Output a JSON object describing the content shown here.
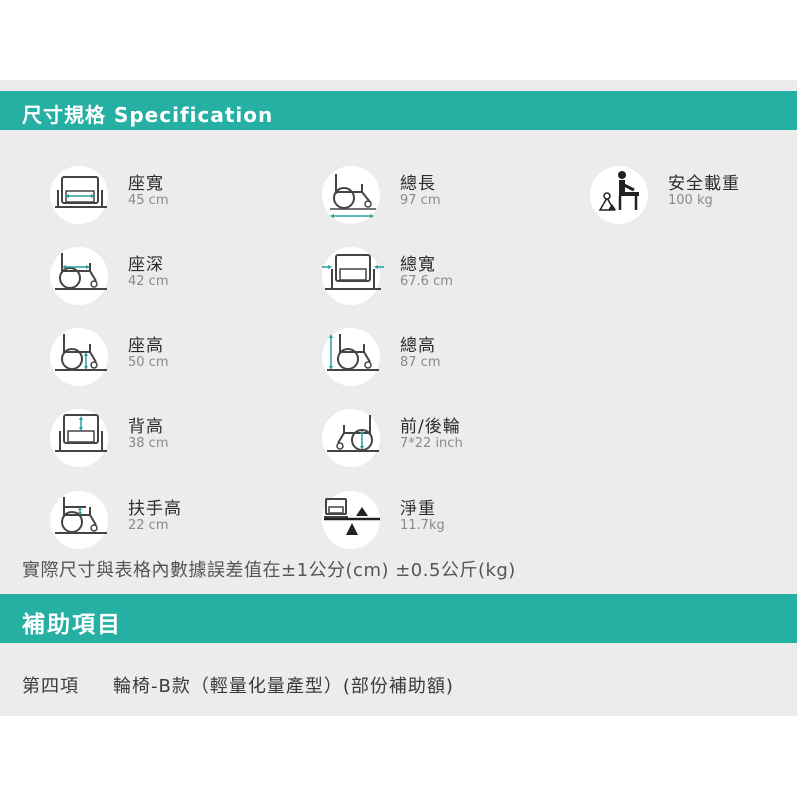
{
  "colors": {
    "accent": "#26b0a3",
    "icon_accent": "#2a9d9b",
    "panel": "#ececec"
  },
  "spec_section": {
    "title": "尺寸規格 Specification"
  },
  "specs": [
    {
      "label": "座寬",
      "value": "45 cm",
      "icon": "seat-width-icon"
    },
    {
      "label": "總長",
      "value": "97 cm",
      "icon": "total-length-icon"
    },
    {
      "label": "安全載重",
      "value": "100 kg",
      "icon": "safe-load-icon"
    },
    {
      "label": "座深",
      "value": "42 cm",
      "icon": "seat-depth-icon"
    },
    {
      "label": "總寬",
      "value": "67.6 cm",
      "icon": "total-width-icon"
    },
    {
      "label": "座高",
      "value": "50 cm",
      "icon": "seat-height-icon"
    },
    {
      "label": "總高",
      "value": "87 cm",
      "icon": "total-height-icon"
    },
    {
      "label": "背高",
      "value": "38 cm",
      "icon": "back-height-icon"
    },
    {
      "label": "前/後輪",
      "value": "7*22 inch",
      "icon": "wheels-icon"
    },
    {
      "label": "扶手高",
      "value": "22 cm",
      "icon": "armrest-height-icon"
    },
    {
      "label": "淨重",
      "value": "11.7kg",
      "icon": "net-weight-icon"
    }
  ],
  "note": "實際尺寸與表格內數據誤差值在±1公分(cm) ±0.5公斤(kg)",
  "subsidy_section": {
    "title": "補助項目"
  },
  "subsidy": {
    "item": "第四項",
    "description": "輪椅-B款（輕量化量產型）(部份補助額)"
  }
}
